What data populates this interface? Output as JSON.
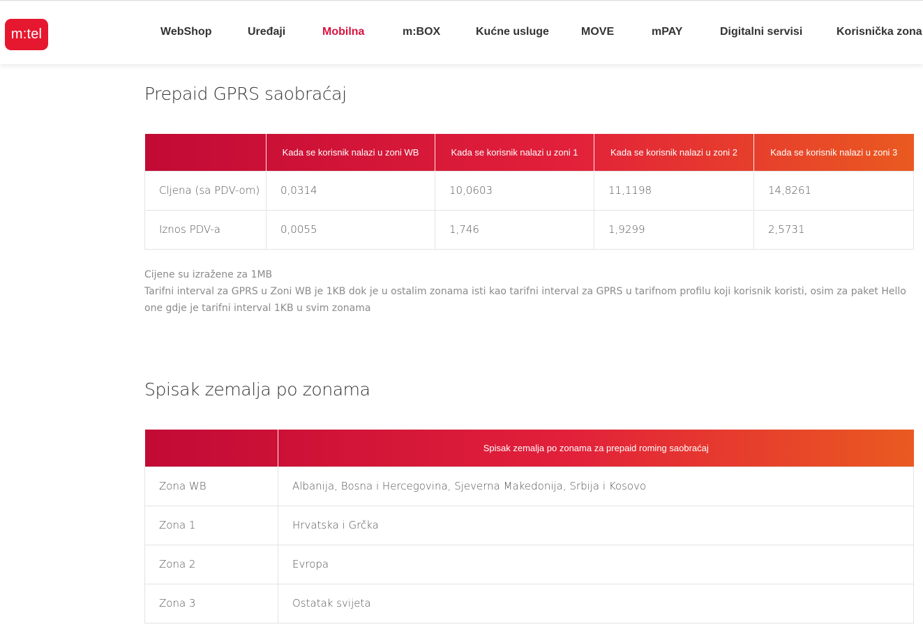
{
  "brand": {
    "logo_text": "m:tel",
    "accent": "#e5182f"
  },
  "nav": {
    "items": [
      {
        "label": "WebShop"
      },
      {
        "label": "Uređaji"
      },
      {
        "label": "Mobilna",
        "active": true
      },
      {
        "label": "m:BOX"
      },
      {
        "label": "Kućne usluge"
      },
      {
        "label": "MOVE"
      },
      {
        "label": "mPAY"
      },
      {
        "label": "Digitalni servisi"
      },
      {
        "label": "Korisnička zona"
      }
    ]
  },
  "gprs": {
    "title": "Prepaid GPRS saobraćaj",
    "headers": [
      "",
      "Kada se korisnik nalazi u zoni WB",
      "Kada se korisnik nalazi u zoni 1",
      "Kada se korisnik nalazi u zoni 2",
      "Kada se korisnik nalazi u zoni 3"
    ],
    "rows": [
      [
        "Cljena (sa PDV-om)",
        "0,0314",
        "10,0603",
        "11,1198",
        "14,8261"
      ],
      [
        "Iznos PDV-a",
        "0,0055",
        "1,746",
        "1,9299",
        "2,5731"
      ]
    ],
    "notes": [
      "Cijene su izražene za 1MB",
      "Tarifni interval za GPRS u Zoni WB je 1KB dok je u ostalim zonama isti kao tarifni interval za GPRS u tarifnom profilu koji korisnik koristi, osim za paket Hello one gdje je tarifni interval 1KB u svim zonama"
    ]
  },
  "zones": {
    "title": "Spisak zemalja po zonama",
    "headers": [
      "",
      "Spisak zemalja po zonama za prepaid roming saobraćaj"
    ],
    "rows": [
      [
        "Zona WB",
        "Albanija, Bosna i Hercegovina, Sjeverna Makedonija, Srbija i Kosovo"
      ],
      [
        "Zona 1",
        "Hrvatska i Grčka"
      ],
      [
        "Zona 2",
        "Evropa"
      ],
      [
        "Zona 3",
        "Ostatak svijeta"
      ]
    ]
  }
}
